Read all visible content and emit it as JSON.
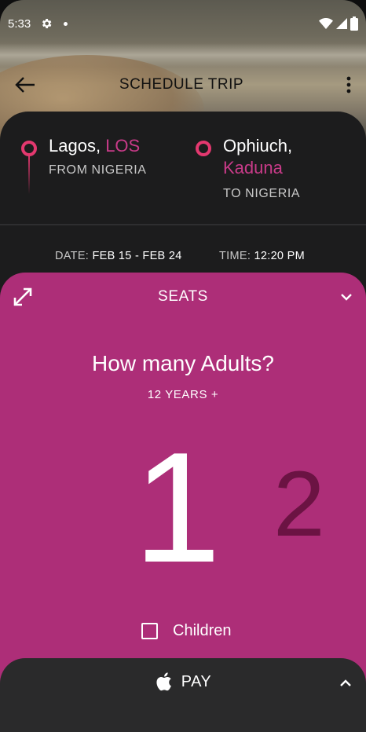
{
  "status_bar": {
    "time": "5:33",
    "icons": [
      "gear-icon",
      "notification-dot-icon",
      "wifi-icon",
      "signal-icon",
      "battery-icon"
    ]
  },
  "app_bar": {
    "title": "SCHEDULE TRIP",
    "back_icon": "arrow-left-icon",
    "menu_icon": "more-vert-icon"
  },
  "trip": {
    "from": {
      "city": "Lagos,",
      "code": "LOS",
      "label": "FROM NIGERIA"
    },
    "to": {
      "city": "Ophiuch,",
      "city_line2": "Kaduna",
      "label": "TO NIGERIA"
    },
    "date_label": "DATE:",
    "date_value": "FEB 15 - FEB 24",
    "time_label": "TIME:",
    "time_value": "12:20 PM"
  },
  "seats": {
    "title": "SEATS",
    "question": "How many Adults?",
    "age_note": "12 YEARS +",
    "selected": "1",
    "next": "2",
    "children_label": "Children",
    "children_checked": false
  },
  "pay": {
    "label": "PAY",
    "icon": "apple-icon"
  },
  "colors": {
    "accent": "#c93b89",
    "seats_bg": "#ad2e78",
    "dim_number": "#6b1343",
    "card_bg": "#1c1c1d",
    "pay_bg": "#2a2a2b"
  }
}
